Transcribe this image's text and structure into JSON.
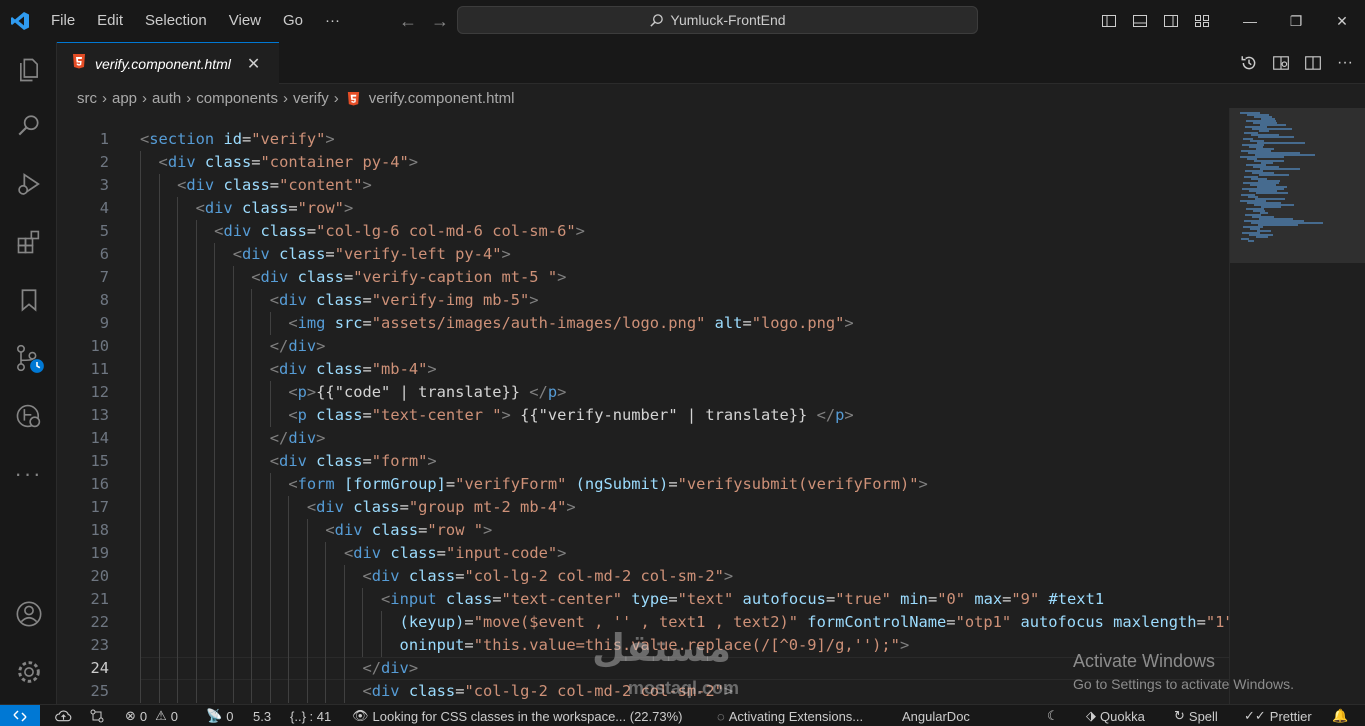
{
  "menu": [
    "File",
    "Edit",
    "Selection",
    "View",
    "Go",
    "···"
  ],
  "search": {
    "text": "Yumluck-FrontEnd"
  },
  "tab": {
    "name": "verify.component.html",
    "close": "✕"
  },
  "breadcrumb": [
    "src",
    "app",
    "auth",
    "components",
    "verify",
    "verify.component.html"
  ],
  "editor": {
    "current_line": 24,
    "lines": [
      {
        "n": "1",
        "indent": 0,
        "tokens": [
          [
            "t",
            "<"
          ],
          [
            "tag",
            "section"
          ],
          [
            "tx",
            " "
          ],
          [
            "at",
            "id"
          ],
          [
            "tx",
            "="
          ],
          [
            "st",
            "\"verify\""
          ],
          [
            "t",
            ">"
          ]
        ]
      },
      {
        "n": "2",
        "indent": 1,
        "tokens": [
          [
            "t",
            "<"
          ],
          [
            "tag",
            "div"
          ],
          [
            "tx",
            " "
          ],
          [
            "at",
            "class"
          ],
          [
            "tx",
            "="
          ],
          [
            "st",
            "\"container py-4\""
          ],
          [
            "t",
            ">"
          ]
        ]
      },
      {
        "n": "3",
        "indent": 2,
        "tokens": [
          [
            "t",
            "<"
          ],
          [
            "tag",
            "div"
          ],
          [
            "tx",
            " "
          ],
          [
            "at",
            "class"
          ],
          [
            "tx",
            "="
          ],
          [
            "st",
            "\"content\""
          ],
          [
            "t",
            ">"
          ]
        ]
      },
      {
        "n": "4",
        "indent": 3,
        "tokens": [
          [
            "t",
            "<"
          ],
          [
            "tag",
            "div"
          ],
          [
            "tx",
            " "
          ],
          [
            "at",
            "class"
          ],
          [
            "tx",
            "="
          ],
          [
            "st",
            "\"row\""
          ],
          [
            "t",
            ">"
          ]
        ]
      },
      {
        "n": "5",
        "indent": 4,
        "tokens": [
          [
            "t",
            "<"
          ],
          [
            "tag",
            "div"
          ],
          [
            "tx",
            " "
          ],
          [
            "at",
            "class"
          ],
          [
            "tx",
            "="
          ],
          [
            "st",
            "\"col-lg-6 col-md-6 col-sm-6\""
          ],
          [
            "t",
            ">"
          ]
        ]
      },
      {
        "n": "6",
        "indent": 5,
        "tokens": [
          [
            "t",
            "<"
          ],
          [
            "tag",
            "div"
          ],
          [
            "tx",
            " "
          ],
          [
            "at",
            "class"
          ],
          [
            "tx",
            "="
          ],
          [
            "st",
            "\"verify-left py-4\""
          ],
          [
            "t",
            ">"
          ]
        ]
      },
      {
        "n": "7",
        "indent": 6,
        "tokens": [
          [
            "t",
            "<"
          ],
          [
            "tag",
            "div"
          ],
          [
            "tx",
            " "
          ],
          [
            "at",
            "class"
          ],
          [
            "tx",
            "="
          ],
          [
            "st",
            "\"verify-caption mt-5 \""
          ],
          [
            "t",
            ">"
          ]
        ]
      },
      {
        "n": "8",
        "indent": 7,
        "tokens": [
          [
            "t",
            "<"
          ],
          [
            "tag",
            "div"
          ],
          [
            "tx",
            " "
          ],
          [
            "at",
            "class"
          ],
          [
            "tx",
            "="
          ],
          [
            "st",
            "\"verify-img mb-5\""
          ],
          [
            "t",
            ">"
          ]
        ]
      },
      {
        "n": "9",
        "indent": 8,
        "tokens": [
          [
            "t",
            "<"
          ],
          [
            "tag",
            "img"
          ],
          [
            "tx",
            " "
          ],
          [
            "at",
            "src"
          ],
          [
            "tx",
            "="
          ],
          [
            "st",
            "\"assets/images/auth-images/logo.png\""
          ],
          [
            "tx",
            " "
          ],
          [
            "at",
            "alt"
          ],
          [
            "tx",
            "="
          ],
          [
            "st",
            "\"logo.png\""
          ],
          [
            "t",
            ">"
          ]
        ]
      },
      {
        "n": "10",
        "indent": 7,
        "tokens": [
          [
            "t",
            "</"
          ],
          [
            "tag",
            "div"
          ],
          [
            "t",
            ">"
          ]
        ]
      },
      {
        "n": "11",
        "indent": 7,
        "tokens": [
          [
            "t",
            "<"
          ],
          [
            "tag",
            "div"
          ],
          [
            "tx",
            " "
          ],
          [
            "at",
            "class"
          ],
          [
            "tx",
            "="
          ],
          [
            "st",
            "\"mb-4\""
          ],
          [
            "t",
            ">"
          ]
        ]
      },
      {
        "n": "12",
        "indent": 8,
        "tokens": [
          [
            "t",
            "<"
          ],
          [
            "tag",
            "p"
          ],
          [
            "t",
            ">"
          ],
          [
            "tx",
            "{{\"code\" | translate}} "
          ],
          [
            "t",
            "</"
          ],
          [
            "tag",
            "p"
          ],
          [
            "t",
            ">"
          ]
        ]
      },
      {
        "n": "13",
        "indent": 8,
        "tokens": [
          [
            "t",
            "<"
          ],
          [
            "tag",
            "p"
          ],
          [
            "tx",
            " "
          ],
          [
            "at",
            "class"
          ],
          [
            "tx",
            "="
          ],
          [
            "st",
            "\"text-center \""
          ],
          [
            "t",
            ">"
          ],
          [
            "tx",
            " {{\"verify-number\" | translate}} "
          ],
          [
            "t",
            "</"
          ],
          [
            "tag",
            "p"
          ],
          [
            "t",
            ">"
          ]
        ]
      },
      {
        "n": "14",
        "indent": 7,
        "tokens": [
          [
            "t",
            "</"
          ],
          [
            "tag",
            "div"
          ],
          [
            "t",
            ">"
          ]
        ]
      },
      {
        "n": "15",
        "indent": 7,
        "tokens": [
          [
            "t",
            "<"
          ],
          [
            "tag",
            "div"
          ],
          [
            "tx",
            " "
          ],
          [
            "at",
            "class"
          ],
          [
            "tx",
            "="
          ],
          [
            "st",
            "\"form\""
          ],
          [
            "t",
            ">"
          ]
        ]
      },
      {
        "n": "16",
        "indent": 8,
        "tokens": [
          [
            "t",
            "<"
          ],
          [
            "tag",
            "form"
          ],
          [
            "tx",
            " "
          ],
          [
            "at",
            "[formGroup]"
          ],
          [
            "tx",
            "="
          ],
          [
            "st",
            "\"verifyForm\""
          ],
          [
            "tx",
            " "
          ],
          [
            "at",
            "(ngSubmit)"
          ],
          [
            "tx",
            "="
          ],
          [
            "st",
            "\"verifysubmit(verifyForm)\""
          ],
          [
            "t",
            ">"
          ]
        ]
      },
      {
        "n": "17",
        "indent": 9,
        "tokens": [
          [
            "t",
            "<"
          ],
          [
            "tag",
            "div"
          ],
          [
            "tx",
            " "
          ],
          [
            "at",
            "class"
          ],
          [
            "tx",
            "="
          ],
          [
            "st",
            "\"group mt-2 mb-4\""
          ],
          [
            "t",
            ">"
          ]
        ]
      },
      {
        "n": "18",
        "indent": 10,
        "tokens": [
          [
            "t",
            "<"
          ],
          [
            "tag",
            "div"
          ],
          [
            "tx",
            " "
          ],
          [
            "at",
            "class"
          ],
          [
            "tx",
            "="
          ],
          [
            "st",
            "\"row \""
          ],
          [
            "t",
            ">"
          ]
        ]
      },
      {
        "n": "19",
        "indent": 11,
        "tokens": [
          [
            "t",
            "<"
          ],
          [
            "tag",
            "div"
          ],
          [
            "tx",
            " "
          ],
          [
            "at",
            "class"
          ],
          [
            "tx",
            "="
          ],
          [
            "st",
            "\"input-code\""
          ],
          [
            "t",
            ">"
          ]
        ]
      },
      {
        "n": "20",
        "indent": 12,
        "tokens": [
          [
            "t",
            "<"
          ],
          [
            "tag",
            "div"
          ],
          [
            "tx",
            " "
          ],
          [
            "at",
            "class"
          ],
          [
            "tx",
            "="
          ],
          [
            "st",
            "\"col-lg-2 col-md-2 col-sm-2\""
          ],
          [
            "t",
            ">"
          ]
        ]
      },
      {
        "n": "21",
        "indent": 13,
        "tokens": [
          [
            "t",
            "<"
          ],
          [
            "tag",
            "input"
          ],
          [
            "tx",
            " "
          ],
          [
            "at",
            "class"
          ],
          [
            "tx",
            "="
          ],
          [
            "st",
            "\"text-center\""
          ],
          [
            "tx",
            " "
          ],
          [
            "at",
            "type"
          ],
          [
            "tx",
            "="
          ],
          [
            "st",
            "\"text\""
          ],
          [
            "tx",
            " "
          ],
          [
            "at",
            "autofocus"
          ],
          [
            "tx",
            "="
          ],
          [
            "st",
            "\"true\""
          ],
          [
            "tx",
            " "
          ],
          [
            "at",
            "min"
          ],
          [
            "tx",
            "="
          ],
          [
            "st",
            "\"0\""
          ],
          [
            "tx",
            " "
          ],
          [
            "at",
            "max"
          ],
          [
            "tx",
            "="
          ],
          [
            "st",
            "\"9\""
          ],
          [
            "tx",
            " "
          ],
          [
            "at",
            "#text1"
          ]
        ]
      },
      {
        "n": "22",
        "indent": 14,
        "tokens": [
          [
            "at",
            "(keyup)"
          ],
          [
            "tx",
            "="
          ],
          [
            "st",
            "\"move($event , '' , text1 , text2)\""
          ],
          [
            "tx",
            " "
          ],
          [
            "at",
            "formControlName"
          ],
          [
            "tx",
            "="
          ],
          [
            "st",
            "\"otp1\""
          ],
          [
            "tx",
            " "
          ],
          [
            "at",
            "autofocus"
          ],
          [
            "tx",
            " "
          ],
          [
            "at",
            "maxlength"
          ],
          [
            "tx",
            "="
          ],
          [
            "st",
            "\"1\""
          ]
        ]
      },
      {
        "n": "23",
        "indent": 14,
        "tokens": [
          [
            "at",
            "oninput"
          ],
          [
            "tx",
            "="
          ],
          [
            "st",
            "\"this.value=this.value.replace(/[^0-9]/g,'');\""
          ],
          [
            "t",
            ">"
          ]
        ]
      },
      {
        "n": "24",
        "indent": 12,
        "tokens": [
          [
            "t",
            "</"
          ],
          [
            "tag",
            "div"
          ],
          [
            "t",
            ">"
          ]
        ]
      },
      {
        "n": "25",
        "indent": 12,
        "tokens": [
          [
            "t",
            "<"
          ],
          [
            "tag",
            "div"
          ],
          [
            "tx",
            " "
          ],
          [
            "at",
            "class"
          ],
          [
            "tx",
            "="
          ],
          [
            "st",
            "\"col-lg-2 col-md-2 col-sm-2\""
          ],
          [
            "t",
            ">"
          ]
        ]
      }
    ]
  },
  "watermark": {
    "line1": "Activate Windows",
    "line2": "Go to Settings to activate Windows.",
    "brand": "مستقل",
    "brand_sub": "mostaql.com"
  },
  "status": {
    "errors": "0",
    "warnings": "0",
    "ports": "0",
    "version": "5.3",
    "braces": "{..} : 41",
    "css": "Looking for CSS classes in the workspace... (22.73%)",
    "extensions": "Activating Extensions...",
    "angular": "AngularDoc",
    "quokka": "Quokka",
    "spell": "Spell",
    "prettier": "Prettier"
  }
}
